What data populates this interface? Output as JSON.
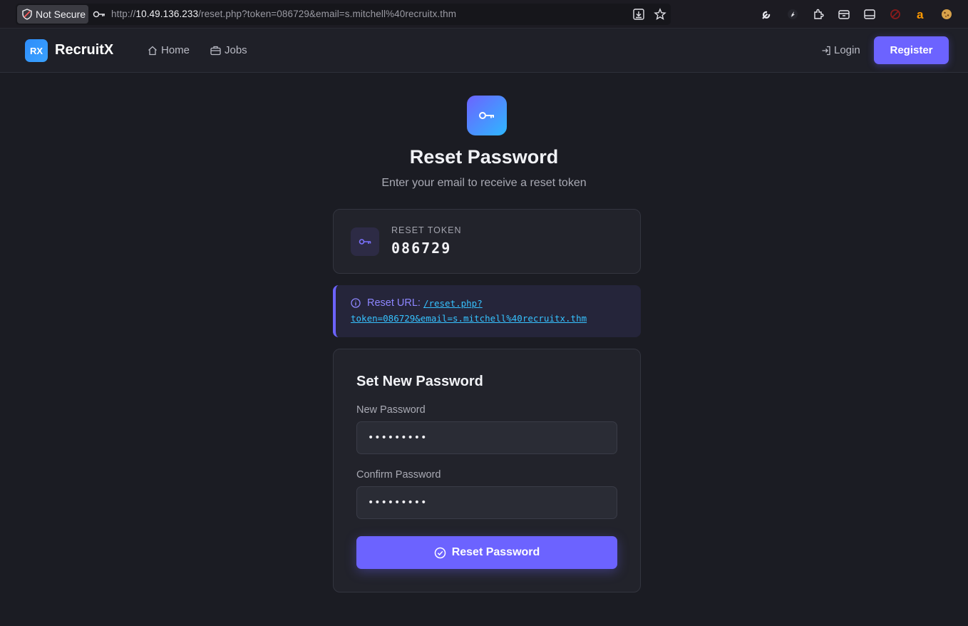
{
  "browser": {
    "security_label": "Not Secure",
    "url_prefix": "http://",
    "url_host": "10.49.136.233",
    "url_path": "/reset.php?token=086729&email=s.mitchell%40recruitx.thm"
  },
  "navbar": {
    "logo_text": "RX",
    "brand": "RecruitX",
    "home_label": "Home",
    "jobs_label": "Jobs",
    "login_label": "Login",
    "register_label": "Register"
  },
  "header": {
    "title": "Reset Password",
    "subtitle": "Enter your email to receive a reset token"
  },
  "token": {
    "label": "RESET TOKEN",
    "value": "086729"
  },
  "alert": {
    "label": "Reset URL:",
    "link_part1": "/reset.php?",
    "link_part2": "token=086729&email=s.mitchell%40recruitx.thm"
  },
  "form": {
    "title": "Set New Password",
    "new_password_label": "New Password",
    "new_password_value": "password1",
    "confirm_password_label": "Confirm Password",
    "confirm_password_value": "password1",
    "submit_label": "Reset Password"
  },
  "colors": {
    "accent": "#6c63ff",
    "link": "#36c2ff",
    "background": "#1b1c23"
  }
}
